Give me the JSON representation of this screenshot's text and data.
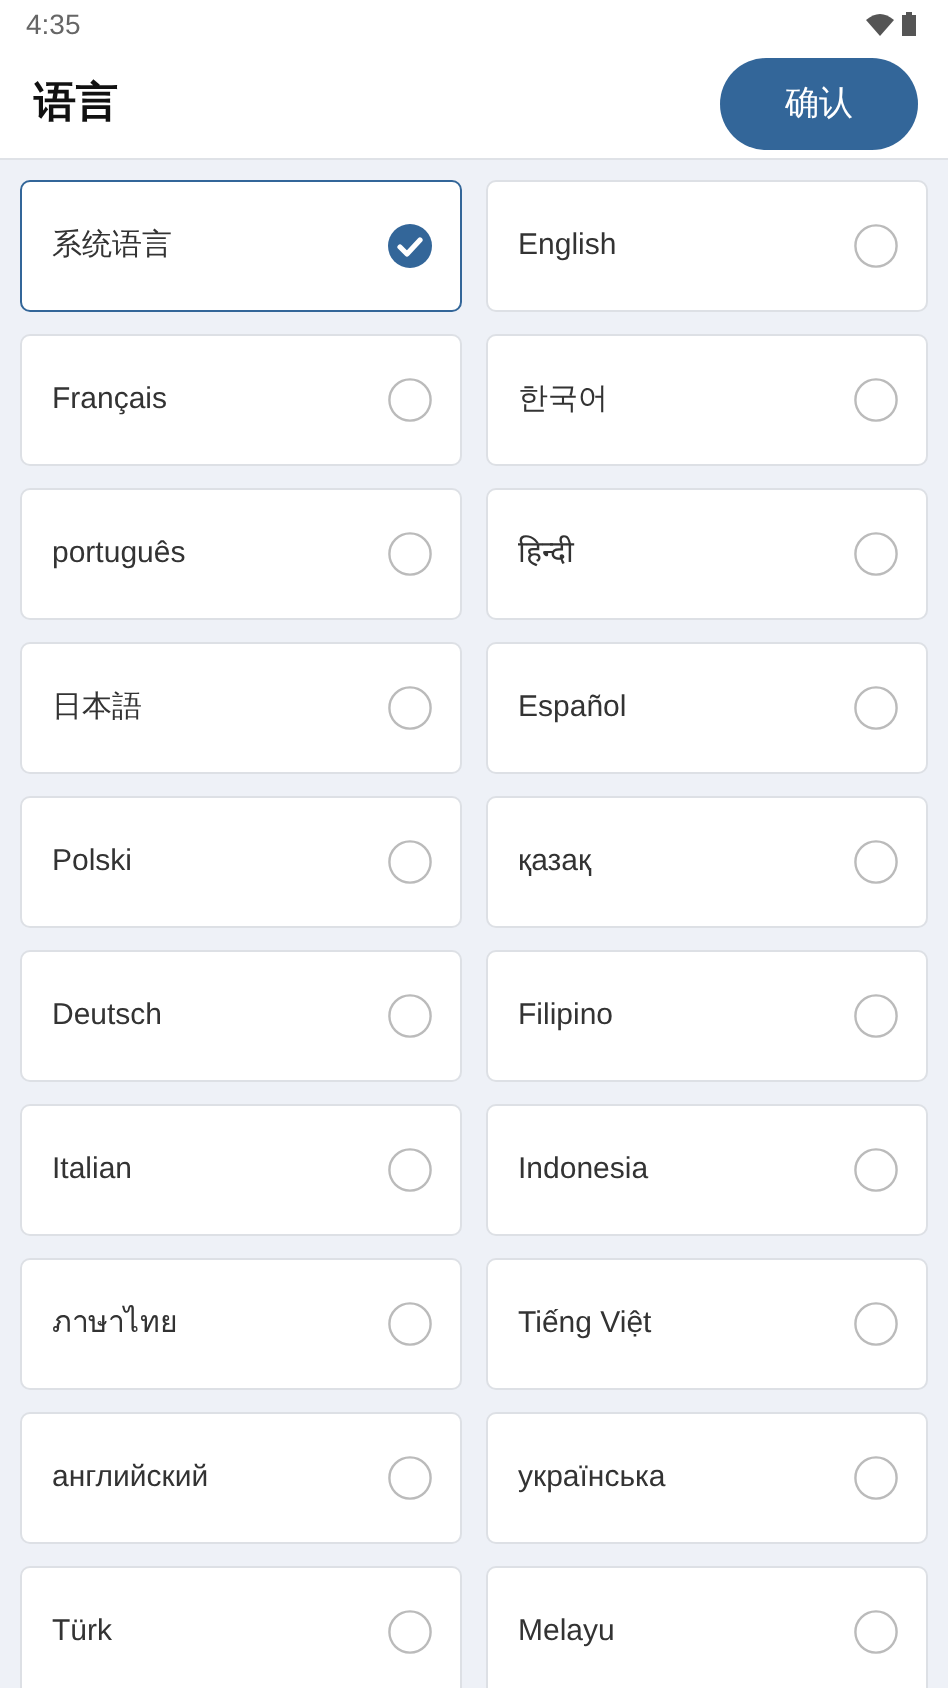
{
  "status_bar": {
    "time": "4:35"
  },
  "header": {
    "title": "语言",
    "confirm_button": "确认"
  },
  "languages": [
    {
      "label": "系统语言",
      "selected": true
    },
    {
      "label": "English",
      "selected": false
    },
    {
      "label": "Français",
      "selected": false
    },
    {
      "label": "한국어",
      "selected": false
    },
    {
      "label": "português",
      "selected": false
    },
    {
      "label": "हिन्दी",
      "selected": false
    },
    {
      "label": "日本語",
      "selected": false
    },
    {
      "label": "Español",
      "selected": false
    },
    {
      "label": "Polski",
      "selected": false
    },
    {
      "label": "қазақ",
      "selected": false
    },
    {
      "label": "Deutsch",
      "selected": false
    },
    {
      "label": "Filipino",
      "selected": false
    },
    {
      "label": "Italian",
      "selected": false
    },
    {
      "label": "Indonesia",
      "selected": false
    },
    {
      "label": "ภาษาไทย",
      "selected": false
    },
    {
      "label": "Tiếng Việt",
      "selected": false
    },
    {
      "label": "английский",
      "selected": false
    },
    {
      "label": "українська",
      "selected": false
    },
    {
      "label": "Türk",
      "selected": false
    },
    {
      "label": "Melayu",
      "selected": false
    }
  ]
}
